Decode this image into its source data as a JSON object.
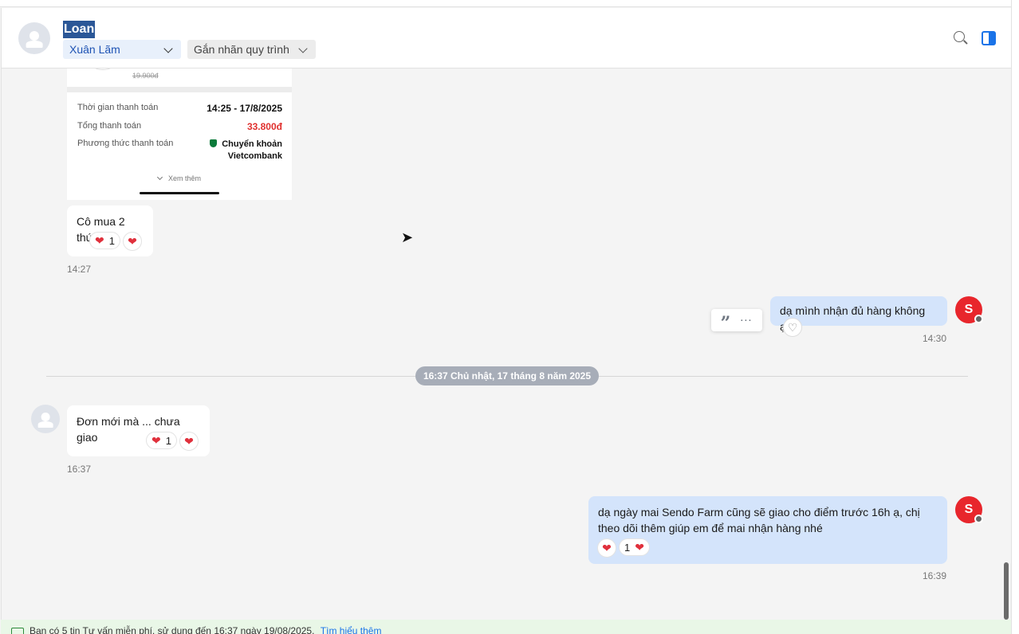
{
  "header": {
    "contact_name": "Loan",
    "assignee": "Xuân Lãm",
    "tag_label": "Gắn nhãn quy trình"
  },
  "receipt": {
    "old_price": "19.900đ",
    "rows": [
      {
        "label": "Thời gian thanh toán",
        "value": "14:25 - 17/8/2025"
      },
      {
        "label": "Tổng thanh toán",
        "value": "33.800đ"
      },
      {
        "label": "Phương thức thanh toán",
        "value_line1": "Chuyển khoản",
        "value_line2": "Vietcombank"
      }
    ],
    "more_label": "Xem thêm"
  },
  "messages": [
    {
      "text": "Cô mua 2 thứ",
      "reaction_count": "1",
      "time": "14:27"
    },
    {
      "text": "dạ mình nhận đủ hàng không ạ?",
      "time": "14:30"
    },
    {
      "text": "Đơn mới mà ... chưa giao",
      "reaction_count": "1",
      "time": "16:37"
    },
    {
      "text_line1": "dạ ngày mai Sendo Farm cũng sẽ giao cho điểm trước 16h ạ, chị",
      "text_line2": "theo dõi thêm giúp em để mai nhận hàng nhé",
      "reaction_count": "1",
      "time": "16:39"
    }
  ],
  "date_divider": "16:37 Chủ nhật, 17 tháng 8 năm 2025",
  "notice": {
    "text": "Bạn có 5 tin Tư vấn miễn phí, sử dụng đến 16:37 ngày 19/08/2025.",
    "link": "Tìm hiểu thêm"
  },
  "icons": {
    "reaction": "heart-icon",
    "brand_color": "#e8262c",
    "accent_color": "#1a73e8"
  }
}
